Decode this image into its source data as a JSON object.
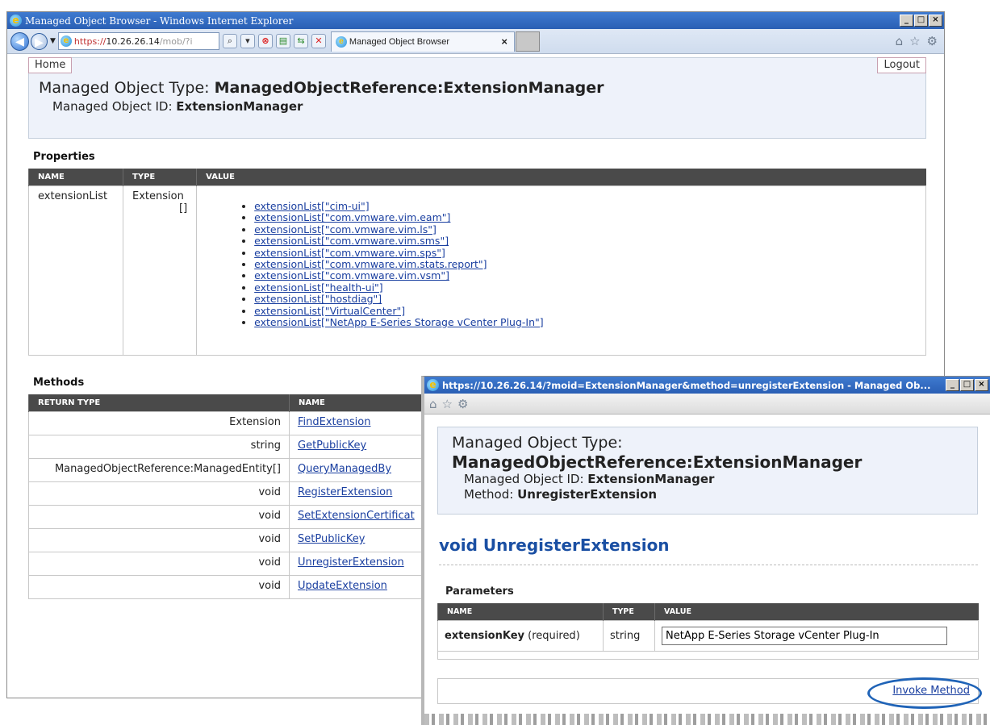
{
  "main_window": {
    "title": "Managed Object Browser - Windows Internet Explorer",
    "address": {
      "scheme": "https://",
      "host": "10.26.26.14",
      "rest": "/mob/?i"
    },
    "tab_title": "Managed Object Browser",
    "home_link": "Home",
    "logout_link": "Logout",
    "object_type_label": "Managed Object Type: ",
    "object_type_value": "ManagedObjectReference:ExtensionManager",
    "object_id_label": "Managed Object ID: ",
    "object_id_value": "ExtensionManager",
    "properties_title": "Properties",
    "properties_headers": [
      "NAME",
      "TYPE",
      "VALUE"
    ],
    "property": {
      "name": "extensionList",
      "type": "Extension",
      "type_suffix": "[]",
      "values": [
        "extensionList[\"cim-ui\"]",
        "extensionList[\"com.vmware.vim.eam\"]",
        "extensionList[\"com.vmware.vim.ls\"]",
        "extensionList[\"com.vmware.vim.sms\"]",
        "extensionList[\"com.vmware.vim.sps\"]",
        "extensionList[\"com.vmware.vim.stats.report\"]",
        "extensionList[\"com.vmware.vim.vsm\"]",
        "extensionList[\"health-ui\"]",
        "extensionList[\"hostdiag\"]",
        "extensionList[\"VirtualCenter\"]",
        "extensionList[\"NetApp E-Series Storage vCenter Plug-In\"]"
      ]
    },
    "methods_title": "Methods",
    "methods_headers": [
      "RETURN TYPE",
      "NAME"
    ],
    "methods": [
      {
        "return_type": "Extension",
        "name": "FindExtension"
      },
      {
        "return_type": "string",
        "name": "GetPublicKey"
      },
      {
        "return_type": "ManagedObjectReference:ManagedEntity[]",
        "name": "QueryManagedBy"
      },
      {
        "return_type": "void",
        "name": "RegisterExtension"
      },
      {
        "return_type": "void",
        "name": "SetExtensionCertificat"
      },
      {
        "return_type": "void",
        "name": "SetPublicKey"
      },
      {
        "return_type": "void",
        "name": "UnregisterExtension"
      },
      {
        "return_type": "void",
        "name": "UpdateExtension"
      }
    ]
  },
  "popup_window": {
    "title": "https://10.26.26.14/?moid=ExtensionManager&method=unregisterExtension - Managed Ob...",
    "object_type_label": "Managed Object Type:",
    "object_type_value": "ManagedObjectReference:ExtensionManager",
    "object_id_label": "Managed Object ID: ",
    "object_id_value": "ExtensionManager",
    "method_label": "Method: ",
    "method_value": "UnregisterExtension",
    "signature": "void UnregisterExtension",
    "parameters_title": "Parameters",
    "param_headers": [
      "NAME",
      "TYPE",
      "VALUE"
    ],
    "param_name": "extensionKey",
    "param_required": " (required)",
    "param_type": "string",
    "param_value": "NetApp E-Series Storage vCenter Plug-In",
    "invoke_label": "Invoke Method"
  },
  "icons": [
    "ie-logo-icon",
    "back-icon",
    "forward-icon",
    "search-icon",
    "refresh-icon",
    "stop-icon",
    "home-icon",
    "favorites-star-icon",
    "gear-icon",
    "close-icon",
    "minimize-icon",
    "maximize-icon"
  ],
  "colors": {
    "titlebar": "#2a5fb4",
    "header_bg": "#eef2fa",
    "table_header": "#4a4a4a",
    "link": "#1a3fa0",
    "signature": "#1a4fa3",
    "highlight_oval": "#1f63b7"
  }
}
